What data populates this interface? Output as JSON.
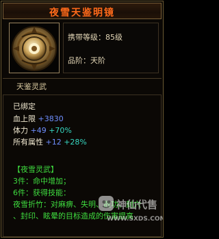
{
  "item": {
    "name": "夜雪天鉴明镜",
    "carry_level_label": "携带等级：",
    "carry_level_value": "85级",
    "grade_label": "品阶：",
    "grade_value": "天阶",
    "subtitle": "天鉴灵武"
  },
  "stats": {
    "bound": "已绑定",
    "hp_label": "血上限",
    "hp_value": "+3830",
    "stamina_label": "体力",
    "stamina_value": "+49",
    "stamina_pct": "+70%",
    "allattr_label": "所有属性",
    "allattr_value": "+12",
    "allattr_pct": "+28%"
  },
  "set": {
    "title": "【夜雪灵武】",
    "line1": "3件：命中增加；",
    "line2": "6件：获得技能：",
    "line3": "夜雪折竹：对麻痹、失明、散功、封穴",
    "line4": "、封印、眩晕的目标造成的伤害提高"
  },
  "watermark": {
    "text": "神仙代售",
    "url": "WWW.SXDS.COM"
  },
  "colors": {
    "title": "#ff6a1a",
    "set_text": "#3fdc3f",
    "stat_white": "#f0e8d0",
    "stat_blue": "#6f8fff",
    "stat_teal": "#37d6c0"
  }
}
